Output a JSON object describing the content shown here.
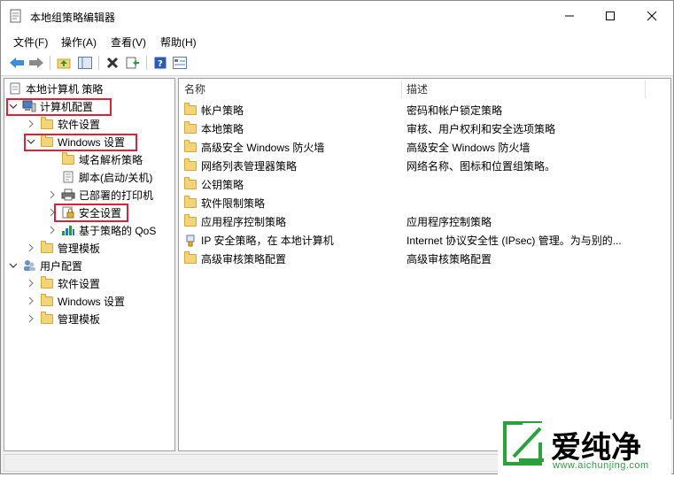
{
  "window": {
    "title": "本地组策略编辑器",
    "minimize": "—",
    "maximize": "☐",
    "close": "✕"
  },
  "menu": [
    "文件(F)",
    "操作(A)",
    "查看(V)",
    "帮助(H)"
  ],
  "toolbar_icons": [
    "back-arrow-icon",
    "forward-arrow-icon",
    "up-folder-icon",
    "show-tree-icon",
    "delete-icon",
    "export-icon",
    "help-icon",
    "properties-icon"
  ],
  "tree": {
    "root": "本地计算机 策略",
    "computer_config": "计算机配置",
    "software_settings": "软件设置",
    "windows_settings": "Windows 设置",
    "dns_policy": "域名解析策略",
    "scripts": "脚本(启动/关机)",
    "printers": "已部署的打印机",
    "security_settings": "安全设置",
    "qos": "基于策略的 QoS",
    "admin_templates": "管理模板",
    "user_config": "用户配置",
    "user_software": "软件设置",
    "user_windows": "Windows 设置",
    "user_admin": "管理模板"
  },
  "list": {
    "col_name": "名称",
    "col_desc": "描述",
    "rows": [
      {
        "name": "帐户策略",
        "desc": "密码和帐户锁定策略"
      },
      {
        "name": "本地策略",
        "desc": "审核、用户权利和安全选项策略"
      },
      {
        "name": "高级安全 Windows 防火墙",
        "desc": "高级安全 Windows 防火墙"
      },
      {
        "name": "网络列表管理器策略",
        "desc": "网络名称、图标和位置组策略。"
      },
      {
        "name": "公钥策略",
        "desc": ""
      },
      {
        "name": "软件限制策略",
        "desc": ""
      },
      {
        "name": "应用程序控制策略",
        "desc": "应用程序控制策略"
      },
      {
        "name": "IP 安全策略，在 本地计算机",
        "desc": "Internet 协议安全性 (IPsec) 管理。为与别的..."
      },
      {
        "name": "高级审核策略配置",
        "desc": "高级审核策略配置"
      }
    ]
  },
  "watermark": {
    "brand": "爱纯净",
    "url": "www.aichunjing.com"
  },
  "colors": {
    "highlight": "#d8243a",
    "watermark_green": "#2aa13a"
  }
}
